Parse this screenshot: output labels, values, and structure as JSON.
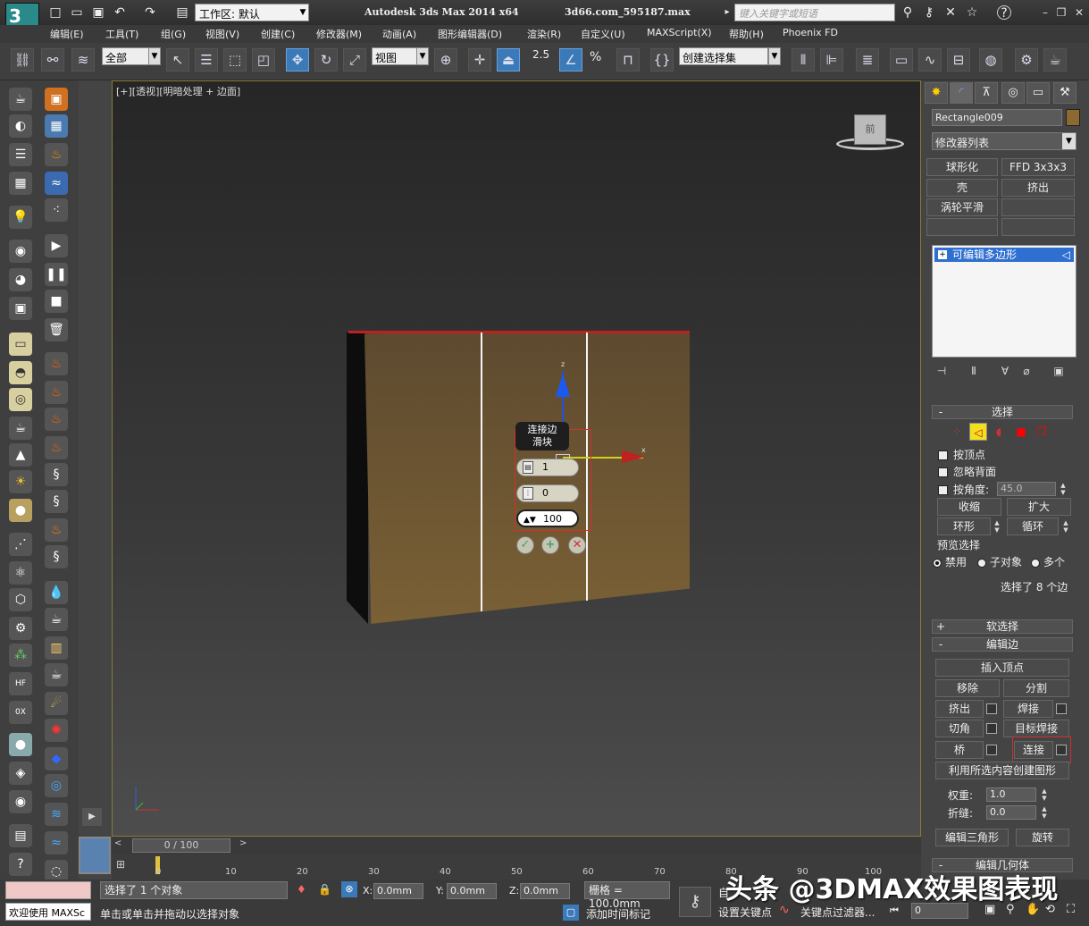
{
  "title_bar": {
    "workspace_label": "工作区: 默认",
    "app_title": "Autodesk 3ds Max  2014 x64",
    "file_name": "3d66.com_595187.max",
    "search_placeholder": "键入关键字或短语",
    "help_label": "?"
  },
  "menus": [
    "编辑(E)",
    "工具(T)",
    "组(G)",
    "视图(V)",
    "创建(C)",
    "修改器(M)",
    "动画(A)",
    "图形编辑器(D)",
    "渲染(R)",
    "自定义(U)",
    "MAXScript(X)",
    "帮助(H)",
    "Phoenix FD"
  ],
  "toolbar": {
    "filter_value": "全部",
    "ref_coord": "视图",
    "selection_set_placeholder": "创建选择集",
    "snap_value": "2.5",
    "percent_label": "%"
  },
  "viewport": {
    "label": "[+][透视][明暗处理 + 边面]",
    "viewcube_face": "前",
    "gizmo_z": "z",
    "gizmo_x": "x"
  },
  "caddy": {
    "title_line1": "连接边",
    "title_line2": "滑块",
    "segments": "1",
    "pinch": "0",
    "slide": "100"
  },
  "right_panel": {
    "object_name": "Rectangle009",
    "modifier_list": "修改器列表",
    "modifier_buttons": [
      "球形化",
      "FFD 3x3x3",
      "壳",
      "挤出",
      "涡轮平滑",
      ""
    ],
    "stack_item": "可编辑多边形",
    "selection_rollout": {
      "title": "选择",
      "by_vertex": "按顶点",
      "ignore_backfacing": "忽略背面",
      "by_angle": "按角度:",
      "angle_value": "45.0",
      "shrink": "收缩",
      "grow": "扩大",
      "ring": "环形",
      "loop": "循环",
      "preview_title": "预览选择",
      "preview_off": "禁用",
      "preview_subobj": "子对象",
      "preview_multi": "多个",
      "status": "选择了 8 个边"
    },
    "soft_selection_title": "软选择",
    "edit_edges": {
      "title": "编辑边",
      "insert_vertex": "插入顶点",
      "remove": "移除",
      "split": "分割",
      "extrude": "挤出",
      "weld": "焊接",
      "chamfer": "切角",
      "target_weld": "目标焊接",
      "bridge": "桥",
      "connect": "连接",
      "create_shape": "利用所选内容创建图形",
      "weight_label": "权重:",
      "weight_value": "1.0",
      "crease_label": "折缝:",
      "crease_value": "0.0",
      "edit_tri": "编辑三角形",
      "turn": "旋转"
    },
    "edit_geometry_title": "编辑几何体"
  },
  "timeline": {
    "slider_label": "0 / 100",
    "ticks": [
      "0",
      "10",
      "20",
      "30",
      "40",
      "50",
      "60",
      "70",
      "80",
      "90",
      "100"
    ]
  },
  "status_bar": {
    "welcome": "欢迎使用 MAXSc",
    "selection_status": "选择了 1 个对象",
    "prompt": "单击或单击并拖动以选择对象",
    "x_label": "X:",
    "x_value": "0.0mm",
    "y_label": "Y:",
    "y_value": "0.0mm",
    "z_label": "Z:",
    "z_value": "0.0mm",
    "grid": "栅格 = 100.0mm",
    "add_time_tag": "添加时间标记",
    "auto_key": "自",
    "set_key": "设置关键点",
    "key_filters": "关键点过滤器...",
    "frame_value": "0"
  },
  "watermark": "头条 @3DMAX效果图表现",
  "colors": {
    "selection_blue": "#2f6fd0",
    "highlight_red": "#d03030",
    "wall_brown": "#6b5432"
  }
}
